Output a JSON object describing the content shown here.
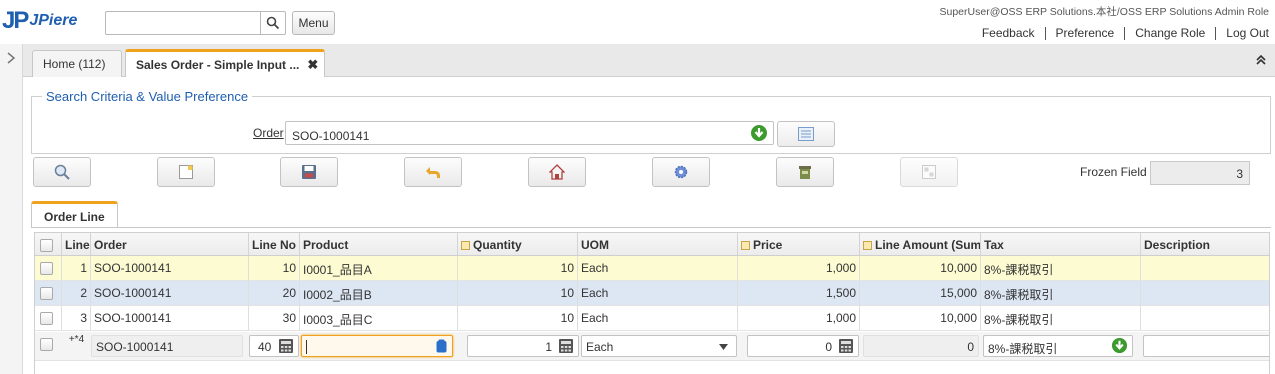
{
  "header": {
    "logo_main": "JP",
    "logo_sub": "JPiere",
    "search_value": "",
    "menu_label": "Menu",
    "user_info": "SuperUser@OSS ERP Solutions.本社/OSS ERP Solutions Admin Role",
    "links": [
      "Feedback",
      "Preference",
      "Change Role",
      "Log Out"
    ]
  },
  "tabs": [
    {
      "label": "Home (112)"
    },
    {
      "label": "Sales Order - Simple Input ...",
      "close": "✖"
    }
  ],
  "criteria": {
    "title": "Search Criteria & Value Preference",
    "order_label": "Order",
    "order_value": "SOO-1000141"
  },
  "toolbar": {
    "buttons": [
      "search-icon",
      "new-record-icon",
      "save-icon",
      "undo-icon",
      "home-icon",
      "settings-icon",
      "delete-icon",
      "customize-icon"
    ],
    "frozen_label": "Frozen Field",
    "frozen_value": "3"
  },
  "subtab": {
    "label": "Order Line"
  },
  "grid": {
    "columns": [
      "Line",
      "Order",
      "Line No",
      "Product",
      "Quantity",
      "UOM",
      "Price",
      "Line Amount (Sum",
      "Tax",
      "Description"
    ],
    "rows": [
      {
        "line": "1",
        "order": "SOO-1000141",
        "line_no": "10",
        "product": "I0001_品目A",
        "qty": "10",
        "uom": "Each",
        "price": "1,000",
        "amount": "10,000",
        "tax": "8%-課税取引",
        "desc": ""
      },
      {
        "line": "2",
        "order": "SOO-1000141",
        "line_no": "20",
        "product": "I0002_品目B",
        "qty": "10",
        "uom": "Each",
        "price": "1,500",
        "amount": "15,000",
        "tax": "8%-課税取引",
        "desc": ""
      },
      {
        "line": "3",
        "order": "SOO-1000141",
        "line_no": "30",
        "product": "I0003_品目C",
        "qty": "10",
        "uom": "Each",
        "price": "1,000",
        "amount": "10,000",
        "tax": "8%-課税取引",
        "desc": ""
      }
    ],
    "edit_row": {
      "line": "+*4",
      "order": "SOO-1000141",
      "line_no": "40",
      "product": "",
      "qty": "1",
      "uom": "Each",
      "price": "0",
      "amount": "0",
      "tax": "8%-課税取引",
      "desc": ""
    }
  },
  "colors": {
    "accent": "#f0a21c",
    "brand": "#1f5fb0",
    "row_highlight": "#fdfbd2",
    "row_selected": "#dde7f4",
    "focus_border": "#f0a21c"
  }
}
